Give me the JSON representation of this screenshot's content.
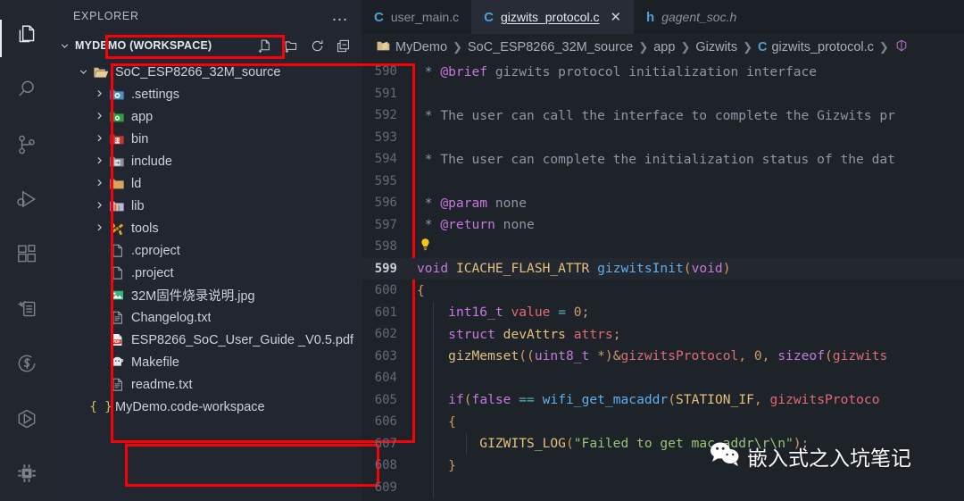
{
  "activity_bar": {
    "items": [
      {
        "name": "explorer",
        "icon": "files-icon",
        "active": true
      },
      {
        "name": "search",
        "icon": "search-icon",
        "active": false
      },
      {
        "name": "source-control",
        "icon": "source-control-icon",
        "active": false
      },
      {
        "name": "run-and-debug",
        "icon": "run-debug-icon",
        "active": false
      },
      {
        "name": "extensions",
        "icon": "extensions-icon",
        "active": false
      },
      {
        "name": "todo-tree",
        "icon": "todo-tree-icon",
        "active": false
      },
      {
        "name": "settings-sync",
        "icon": "s-circle-icon",
        "active": false
      },
      {
        "name": "platformio",
        "icon": "hexagon-play-icon",
        "active": false
      },
      {
        "name": "embedded-tools",
        "icon": "chip-icon",
        "active": false
      }
    ]
  },
  "sidebar": {
    "title": "EXPLORER",
    "more_actions": "…",
    "workspace": {
      "label": "MYDEMO (WORKSPACE)",
      "expanded": true,
      "actions": [
        {
          "name": "new-file",
          "icon": "new-file-icon"
        },
        {
          "name": "new-folder",
          "icon": "new-folder-icon"
        },
        {
          "name": "refresh",
          "icon": "refresh-icon"
        },
        {
          "name": "collapse-all",
          "icon": "collapse-all-icon"
        }
      ]
    },
    "tree": [
      {
        "label": "SoC_ESP8266_32M_source",
        "type": "folder",
        "indent": 0,
        "expanded": true,
        "icon": "folder-open-icon"
      },
      {
        "label": ".settings",
        "type": "folder",
        "indent": 1,
        "expanded": false,
        "icon": "folder-settings-icon"
      },
      {
        "label": "app",
        "type": "folder",
        "indent": 1,
        "expanded": false,
        "icon": "folder-app-icon"
      },
      {
        "label": "bin",
        "type": "folder",
        "indent": 1,
        "expanded": false,
        "icon": "folder-bin-icon"
      },
      {
        "label": "include",
        "type": "folder",
        "indent": 1,
        "expanded": false,
        "icon": "folder-include-icon"
      },
      {
        "label": "ld",
        "type": "folder",
        "indent": 1,
        "expanded": false,
        "icon": "folder-generic-icon"
      },
      {
        "label": "lib",
        "type": "folder",
        "indent": 1,
        "expanded": false,
        "icon": "folder-lib-icon"
      },
      {
        "label": "tools",
        "type": "folder",
        "indent": 1,
        "expanded": false,
        "icon": "folder-tools-icon"
      },
      {
        "label": ".cproject",
        "type": "file",
        "indent": 1,
        "icon": "blank-file-icon"
      },
      {
        "label": ".project",
        "type": "file",
        "indent": 1,
        "icon": "blank-file-icon"
      },
      {
        "label": "32M固件烧录说明.jpg",
        "type": "file",
        "indent": 1,
        "icon": "image-file-icon"
      },
      {
        "label": "Changelog.txt",
        "type": "file",
        "indent": 1,
        "icon": "text-file-icon"
      },
      {
        "label": "ESP8266_SoC_User_Guide _V0.5.pdf",
        "type": "file",
        "indent": 1,
        "icon": "pdf-file-icon"
      },
      {
        "label": "Makefile",
        "type": "file",
        "indent": 1,
        "icon": "makefile-icon"
      },
      {
        "label": "readme.txt",
        "type": "file",
        "indent": 1,
        "icon": "text-file-icon"
      },
      {
        "label": "MyDemo.code-workspace",
        "type": "file",
        "indent": 0,
        "icon": "code-workspace-icon"
      }
    ]
  },
  "editor": {
    "tabs": [
      {
        "label": "user_main.c",
        "icon_letter": "C",
        "active": false,
        "dirty": false,
        "preview": false,
        "closable": false
      },
      {
        "label": "gizwits_protocol.c",
        "icon_letter": "C",
        "active": true,
        "dirty": false,
        "preview": false,
        "closable": true,
        "close_label": "✕"
      },
      {
        "label": "gagent_soc.h",
        "icon_letter": "h",
        "active": false,
        "dirty": false,
        "preview": true,
        "closable": false
      }
    ],
    "breadcrumb": [
      {
        "label": "MyDemo",
        "icon": "folder-icon"
      },
      {
        "label": "SoC_ESP8266_32M_source",
        "icon": ""
      },
      {
        "label": "app",
        "icon": ""
      },
      {
        "label": "Gizwits",
        "icon": ""
      },
      {
        "label": "gizwits_protocol.c",
        "icon": "c-file-icon"
      },
      {
        "label": "",
        "icon": "symbol-icon"
      }
    ],
    "breadcrumb_separator": "❯",
    "active_line": 599,
    "lines": [
      {
        "n": "590",
        "text": " * @brief gizwits protocol initialization interface"
      },
      {
        "n": "591",
        "text": ""
      },
      {
        "n": "592",
        "text": " * The user can call the interface to complete the Gizwits pr"
      },
      {
        "n": "593",
        "text": ""
      },
      {
        "n": "594",
        "text": " * The user can complete the initialization status of the dat"
      },
      {
        "n": "595",
        "text": ""
      },
      {
        "n": "596",
        "text": " * @param none"
      },
      {
        "n": "597",
        "text": " * @return none"
      },
      {
        "n": "598",
        "text": " */"
      },
      {
        "n": "599",
        "text": "void ICACHE_FLASH_ATTR gizwitsInit(void)"
      },
      {
        "n": "600",
        "text": "{"
      },
      {
        "n": "601",
        "text": "    int16_t value = 0;"
      },
      {
        "n": "602",
        "text": "    struct devAttrs attrs;"
      },
      {
        "n": "603",
        "text": "    gizMemset((uint8_t *)&gizwitsProtocol, 0, sizeof(gizwits"
      },
      {
        "n": "604",
        "text": ""
      },
      {
        "n": "605",
        "text": "    if(false == wifi_get_macaddr(STATION_IF, gizwitsProtoco"
      },
      {
        "n": "606",
        "text": "    {"
      },
      {
        "n": "607",
        "text": "        GIZWITS_LOG(\"Failed to get mac addr\\r\\n\");"
      },
      {
        "n": "608",
        "text": "    }"
      },
      {
        "n": "609",
        "text": ""
      }
    ],
    "lightbulb_line": "598",
    "lightbulb_icon": "lightbulb-icon"
  },
  "annotations": [
    {
      "name": "workspace-root-highlight",
      "color": "#fb0007"
    },
    {
      "name": "project-tree-highlight",
      "color": "#fb0007"
    },
    {
      "name": "workspace-file-highlight",
      "color": "#fb0007"
    }
  ],
  "watermark": {
    "text": "嵌入式之入坑笔记",
    "icon": "wechat-icon"
  },
  "colors": {
    "accent_red": "#fb0007",
    "tab_active_bg": "#272c36",
    "sidebar_bg": "#212630",
    "editor_bg": "#1e2229",
    "activitybar_bg": "#22272e",
    "c_icon_blue": "#4ea0d6"
  }
}
